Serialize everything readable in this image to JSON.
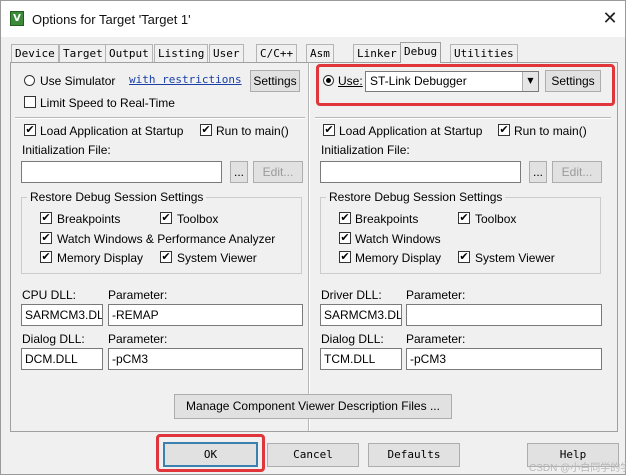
{
  "window": {
    "title": "Options for Target 'Target 1'",
    "app_icon_glyph": "V",
    "close_glyph": "✕"
  },
  "tabs": [
    "Device",
    "Target",
    "Output",
    "Listing",
    "User",
    "C/C++",
    "Asm",
    "Linker",
    "Debug",
    "Utilities"
  ],
  "active_tab": "Debug",
  "left": {
    "use_simulator_label": "Use Simulator",
    "use_simulator_selected": false,
    "restrictions_link": "with restrictions",
    "settings_label": "Settings",
    "limit_speed_label": "Limit Speed to Real-Time",
    "limit_speed_checked": false,
    "load_app_label": "Load Application at Startup",
    "load_app_checked": true,
    "run_main_label": "Run to main()",
    "run_main_checked": true,
    "init_file_label": "Initialization File:",
    "init_file_value": "",
    "browse_label": "...",
    "edit_label": "Edit...",
    "restore_group_title": "Restore Debug Session Settings",
    "breakpoints_label": "Breakpoints",
    "toolbox_label": "Toolbox",
    "watch_label": "Watch Windows & Performance Analyzer",
    "memory_label": "Memory Display",
    "system_viewer_label": "System Viewer",
    "cpu_dll_label": "CPU DLL:",
    "cpu_param_label": "Parameter:",
    "cpu_dll_value": "SARMCM3.DLL",
    "cpu_param_value": "-REMAP",
    "dialog_dll_label": "Dialog DLL:",
    "dialog_param_label": "Parameter:",
    "dialog_dll_value": "DCM.DLL",
    "dialog_param_value": "-pCM3"
  },
  "right": {
    "use_label": "Use:",
    "use_selected": true,
    "debugger_value": "ST-Link Debugger",
    "settings_label": "Settings",
    "load_app_label": "Load Application at Startup",
    "load_app_checked": true,
    "run_main_label": "Run to main()",
    "run_main_checked": true,
    "init_file_label": "Initialization File:",
    "init_file_value": "",
    "browse_label": "...",
    "edit_label": "Edit...",
    "restore_group_title": "Restore Debug Session Settings",
    "breakpoints_label": "Breakpoints",
    "toolbox_label": "Toolbox",
    "watch_label": "Watch Windows",
    "memory_label": "Memory Display",
    "system_viewer_label": "System Viewer",
    "driver_dll_label": "Driver DLL:",
    "driver_param_label": "Parameter:",
    "driver_dll_value": "SARMCM3.DLL",
    "driver_param_value": "",
    "dialog_dll_label": "Dialog DLL:",
    "dialog_param_label": "Parameter:",
    "dialog_dll_value": "TCM.DLL",
    "dialog_param_value": "-pCM3"
  },
  "manage_button_label": "Manage Component Viewer Description Files ...",
  "footer": {
    "ok": "OK",
    "cancel": "Cancel",
    "defaults": "Defaults",
    "help": "Help"
  },
  "check_glyph": "✔",
  "watermark_text": "CSDN @小白同学的学习",
  "colors": {
    "highlight": "#e0353a",
    "link": "#1a3fa6",
    "default_button_border": "#3c7fb1"
  }
}
